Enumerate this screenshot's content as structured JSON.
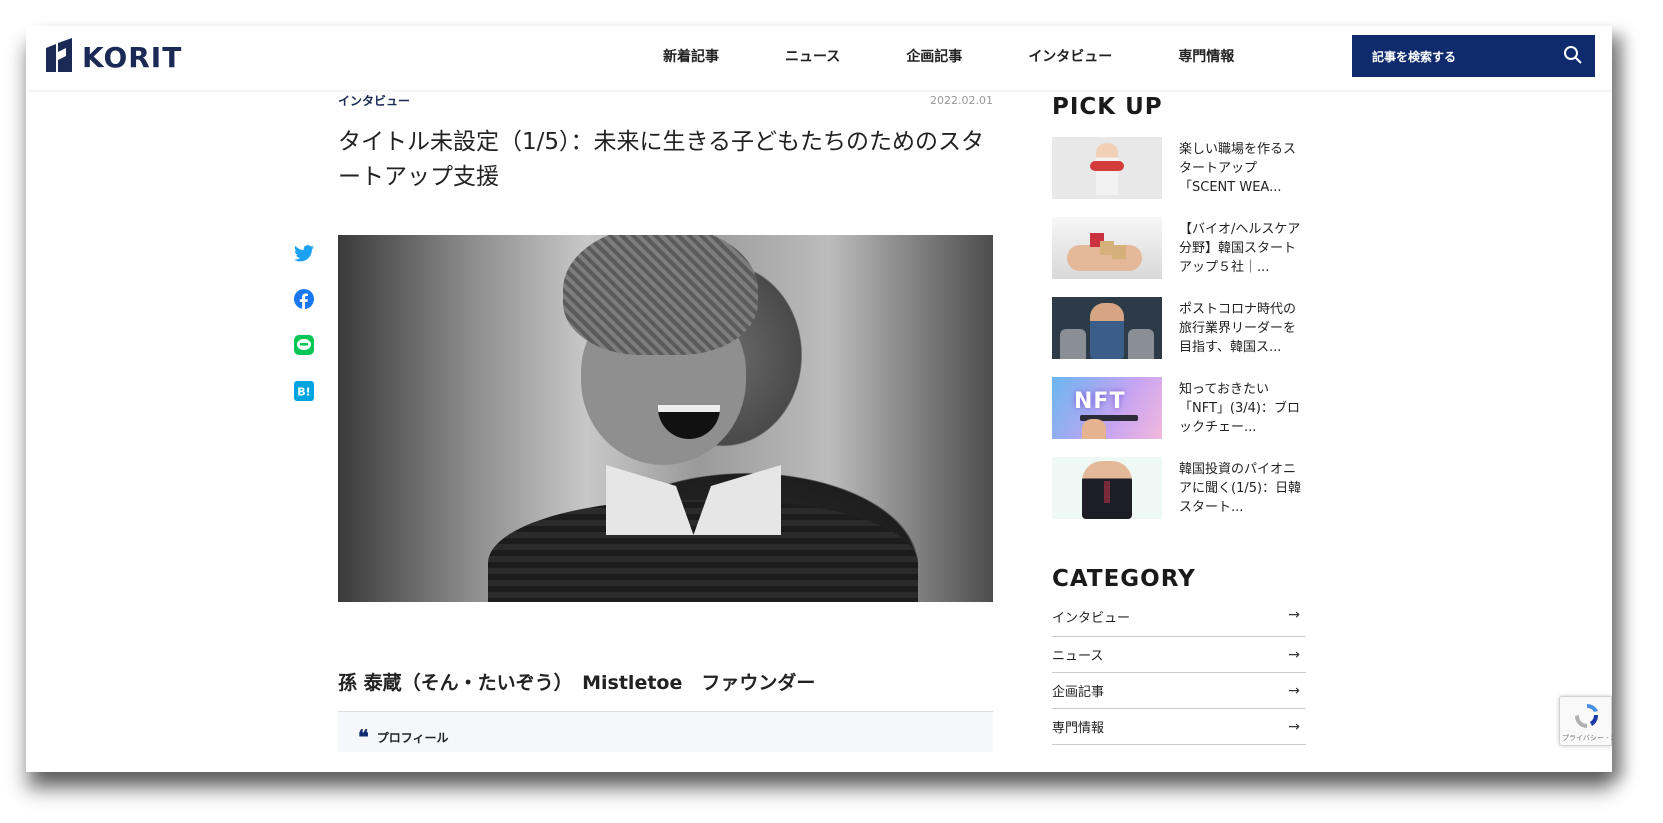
{
  "header": {
    "logo_text": "KORIT",
    "nav": [
      "新着記事",
      "ニュース",
      "企画記事",
      "インタビュー",
      "専門情報"
    ],
    "search_label": "記事を検索する"
  },
  "article": {
    "category": "インタビュー",
    "date": "2022.02.01",
    "title": "タイトル未設定（1/5）：未来に生きる子どもたちのためのスタートアップ支援",
    "person": "孫 泰蔵（そん・たいぞう）　Mistletoe　ファウンダー",
    "profile_label": "プロフィール",
    "quote_mark": "❝"
  },
  "share": [
    "twitter",
    "facebook",
    "line",
    "hatena"
  ],
  "sidebar": {
    "pickup_heading": "PICK UP",
    "pickup": [
      "楽しい職場を作るスタートアップ「SCENT WEA...",
      "【バイオ/ヘルスケア分野】韓国スタートアップ５社｜...",
      "ポストコロナ時代の旅行業界リーダーを目指す、韓国ス...",
      "知っておきたい「NFT」(3/4)：ブロックチェー...",
      "韓国投資のパイオニアに聞く(1/5)：日韓スタート..."
    ],
    "category_heading": "CATEGORY",
    "categories": [
      "インタビュー",
      "ニュース",
      "企画記事",
      "専門情報"
    ],
    "arrow": "→"
  },
  "recaptcha": {
    "text": "プライバシー - 利用規約"
  },
  "colors": {
    "brand_navy": "#0f2b6e",
    "twitter": "#1da1f2",
    "facebook": "#1877f2",
    "line": "#06c755",
    "hatena": "#00a4de"
  }
}
